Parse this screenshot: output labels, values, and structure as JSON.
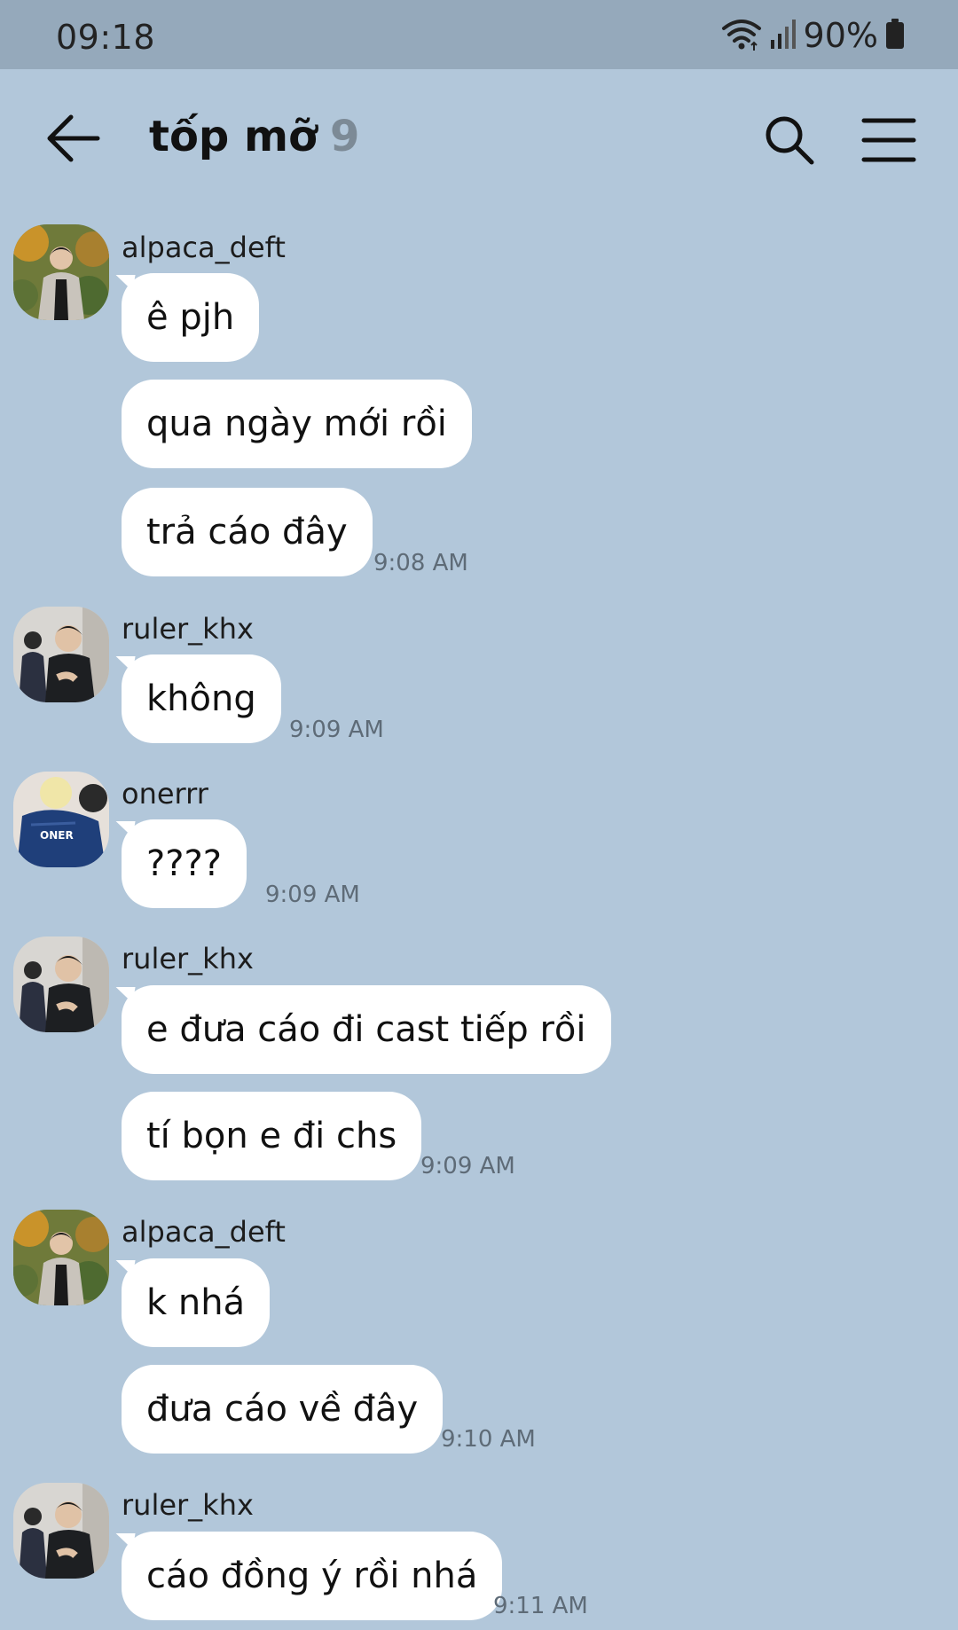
{
  "status_bar": {
    "time": "09:18",
    "battery": "90%",
    "wifi_icon": "wifi-icon",
    "signal_icon": "signal-icon",
    "battery_icon": "battery-icon"
  },
  "header": {
    "title": "tốp mỡ",
    "member_count": "9",
    "back_icon": "back-arrow-icon",
    "search_icon": "search-icon",
    "menu_icon": "menu-icon"
  },
  "messages": [
    {
      "sender": "alpaca_deft",
      "bubbles": [
        "ê pjh",
        "qua ngày mới rồi",
        "trả cáo đây"
      ],
      "time": "9:08 AM"
    },
    {
      "sender": "ruler_khx",
      "bubbles": [
        "không"
      ],
      "time": "9:09 AM"
    },
    {
      "sender": "onerrr",
      "bubbles": [
        "????"
      ],
      "time": "9:09 AM"
    },
    {
      "sender": "ruler_khx",
      "bubbles": [
        "e đưa cáo đi cast tiếp rồi",
        "tí bọn e đi chs"
      ],
      "time": "9:09 AM"
    },
    {
      "sender": "alpaca_deft",
      "bubbles": [
        "k nhá",
        "đưa cáo về đây"
      ],
      "time": "9:10 AM"
    },
    {
      "sender": "ruler_khx",
      "bubbles": [
        "cáo đồng ý rồi nhá"
      ],
      "time": "9:11 AM"
    }
  ],
  "avatar_jersey_text": "ONER",
  "colors": {
    "background": "#b2c7da",
    "status_bar": "#95a9bb",
    "bubble": "#ffffff",
    "timestamp": "#5e6b77",
    "member_count": "#7c8a96"
  }
}
